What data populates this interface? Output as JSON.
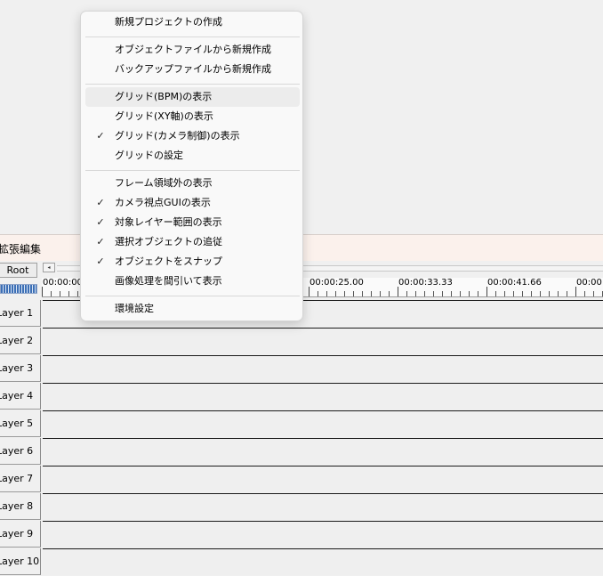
{
  "window": {
    "title": "拡張編集"
  },
  "toolbar": {
    "root_label": "Root",
    "scroll_left_glyph": "◂"
  },
  "ruler": {
    "times": [
      "00:00:00",
      "00:00:25.00",
      "00:00:33.33",
      "00:00:41.66",
      "00:00"
    ]
  },
  "layers": [
    {
      "label": "Layer 1"
    },
    {
      "label": "Layer 2"
    },
    {
      "label": "Layer 3"
    },
    {
      "label": "Layer 4"
    },
    {
      "label": "Layer 5"
    },
    {
      "label": "Layer 6"
    },
    {
      "label": "Layer 7"
    },
    {
      "label": "Layer 8"
    },
    {
      "label": "Layer 9"
    },
    {
      "label": "Layer 10"
    }
  ],
  "menu": {
    "items": [
      {
        "label": "新規プロジェクトの作成",
        "checked": false
      },
      {
        "label": "オブジェクトファイルから新規作成",
        "checked": false
      },
      {
        "label": "バックアップファイルから新規作成",
        "checked": false
      },
      {
        "label": "グリッド(BPM)の表示",
        "checked": false,
        "hover": true
      },
      {
        "label": "グリッド(XY軸)の表示",
        "checked": false
      },
      {
        "label": "グリッド(カメラ制御)の表示",
        "checked": true
      },
      {
        "label": "グリッドの設定",
        "checked": false
      },
      {
        "label": "フレーム領域外の表示",
        "checked": false
      },
      {
        "label": "カメラ視点GUIの表示",
        "checked": true
      },
      {
        "label": "対象レイヤー範囲の表示",
        "checked": true
      },
      {
        "label": "選択オブジェクトの追従",
        "checked": true
      },
      {
        "label": "オブジェクトをスナップ",
        "checked": true
      },
      {
        "label": "画像処理を間引いて表示",
        "checked": false
      },
      {
        "label": "環境設定",
        "checked": false
      }
    ],
    "check_glyph": "✓"
  }
}
